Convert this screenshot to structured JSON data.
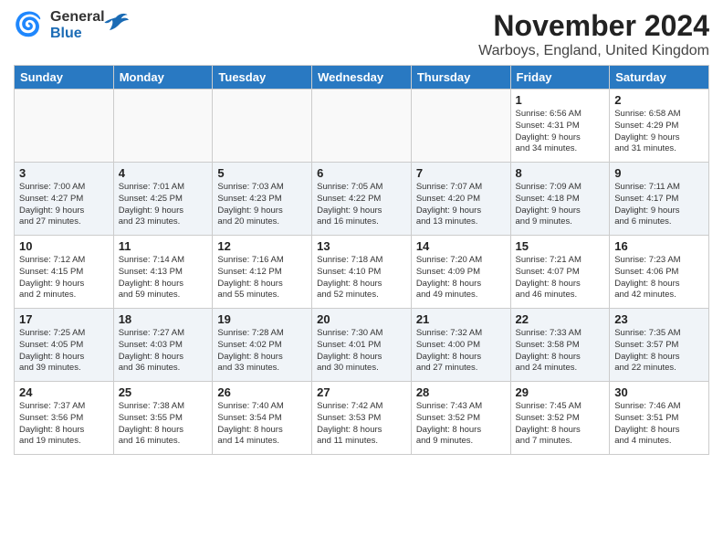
{
  "header": {
    "month_title": "November 2024",
    "location": "Warboys, England, United Kingdom",
    "logo_general": "General",
    "logo_blue": "Blue"
  },
  "weekdays": [
    "Sunday",
    "Monday",
    "Tuesday",
    "Wednesday",
    "Thursday",
    "Friday",
    "Saturday"
  ],
  "weeks": [
    {
      "row_alt": false,
      "days": [
        {
          "num": "",
          "info": ""
        },
        {
          "num": "",
          "info": ""
        },
        {
          "num": "",
          "info": ""
        },
        {
          "num": "",
          "info": ""
        },
        {
          "num": "",
          "info": ""
        },
        {
          "num": "1",
          "info": "Sunrise: 6:56 AM\nSunset: 4:31 PM\nDaylight: 9 hours\nand 34 minutes."
        },
        {
          "num": "2",
          "info": "Sunrise: 6:58 AM\nSunset: 4:29 PM\nDaylight: 9 hours\nand 31 minutes."
        }
      ]
    },
    {
      "row_alt": true,
      "days": [
        {
          "num": "3",
          "info": "Sunrise: 7:00 AM\nSunset: 4:27 PM\nDaylight: 9 hours\nand 27 minutes."
        },
        {
          "num": "4",
          "info": "Sunrise: 7:01 AM\nSunset: 4:25 PM\nDaylight: 9 hours\nand 23 minutes."
        },
        {
          "num": "5",
          "info": "Sunrise: 7:03 AM\nSunset: 4:23 PM\nDaylight: 9 hours\nand 20 minutes."
        },
        {
          "num": "6",
          "info": "Sunrise: 7:05 AM\nSunset: 4:22 PM\nDaylight: 9 hours\nand 16 minutes."
        },
        {
          "num": "7",
          "info": "Sunrise: 7:07 AM\nSunset: 4:20 PM\nDaylight: 9 hours\nand 13 minutes."
        },
        {
          "num": "8",
          "info": "Sunrise: 7:09 AM\nSunset: 4:18 PM\nDaylight: 9 hours\nand 9 minutes."
        },
        {
          "num": "9",
          "info": "Sunrise: 7:11 AM\nSunset: 4:17 PM\nDaylight: 9 hours\nand 6 minutes."
        }
      ]
    },
    {
      "row_alt": false,
      "days": [
        {
          "num": "10",
          "info": "Sunrise: 7:12 AM\nSunset: 4:15 PM\nDaylight: 9 hours\nand 2 minutes."
        },
        {
          "num": "11",
          "info": "Sunrise: 7:14 AM\nSunset: 4:13 PM\nDaylight: 8 hours\nand 59 minutes."
        },
        {
          "num": "12",
          "info": "Sunrise: 7:16 AM\nSunset: 4:12 PM\nDaylight: 8 hours\nand 55 minutes."
        },
        {
          "num": "13",
          "info": "Sunrise: 7:18 AM\nSunset: 4:10 PM\nDaylight: 8 hours\nand 52 minutes."
        },
        {
          "num": "14",
          "info": "Sunrise: 7:20 AM\nSunset: 4:09 PM\nDaylight: 8 hours\nand 49 minutes."
        },
        {
          "num": "15",
          "info": "Sunrise: 7:21 AM\nSunset: 4:07 PM\nDaylight: 8 hours\nand 46 minutes."
        },
        {
          "num": "16",
          "info": "Sunrise: 7:23 AM\nSunset: 4:06 PM\nDaylight: 8 hours\nand 42 minutes."
        }
      ]
    },
    {
      "row_alt": true,
      "days": [
        {
          "num": "17",
          "info": "Sunrise: 7:25 AM\nSunset: 4:05 PM\nDaylight: 8 hours\nand 39 minutes."
        },
        {
          "num": "18",
          "info": "Sunrise: 7:27 AM\nSunset: 4:03 PM\nDaylight: 8 hours\nand 36 minutes."
        },
        {
          "num": "19",
          "info": "Sunrise: 7:28 AM\nSunset: 4:02 PM\nDaylight: 8 hours\nand 33 minutes."
        },
        {
          "num": "20",
          "info": "Sunrise: 7:30 AM\nSunset: 4:01 PM\nDaylight: 8 hours\nand 30 minutes."
        },
        {
          "num": "21",
          "info": "Sunrise: 7:32 AM\nSunset: 4:00 PM\nDaylight: 8 hours\nand 27 minutes."
        },
        {
          "num": "22",
          "info": "Sunrise: 7:33 AM\nSunset: 3:58 PM\nDaylight: 8 hours\nand 24 minutes."
        },
        {
          "num": "23",
          "info": "Sunrise: 7:35 AM\nSunset: 3:57 PM\nDaylight: 8 hours\nand 22 minutes."
        }
      ]
    },
    {
      "row_alt": false,
      "days": [
        {
          "num": "24",
          "info": "Sunrise: 7:37 AM\nSunset: 3:56 PM\nDaylight: 8 hours\nand 19 minutes."
        },
        {
          "num": "25",
          "info": "Sunrise: 7:38 AM\nSunset: 3:55 PM\nDaylight: 8 hours\nand 16 minutes."
        },
        {
          "num": "26",
          "info": "Sunrise: 7:40 AM\nSunset: 3:54 PM\nDaylight: 8 hours\nand 14 minutes."
        },
        {
          "num": "27",
          "info": "Sunrise: 7:42 AM\nSunset: 3:53 PM\nDaylight: 8 hours\nand 11 minutes."
        },
        {
          "num": "28",
          "info": "Sunrise: 7:43 AM\nSunset: 3:52 PM\nDaylight: 8 hours\nand 9 minutes."
        },
        {
          "num": "29",
          "info": "Sunrise: 7:45 AM\nSunset: 3:52 PM\nDaylight: 8 hours\nand 7 minutes."
        },
        {
          "num": "30",
          "info": "Sunrise: 7:46 AM\nSunset: 3:51 PM\nDaylight: 8 hours\nand 4 minutes."
        }
      ]
    }
  ]
}
